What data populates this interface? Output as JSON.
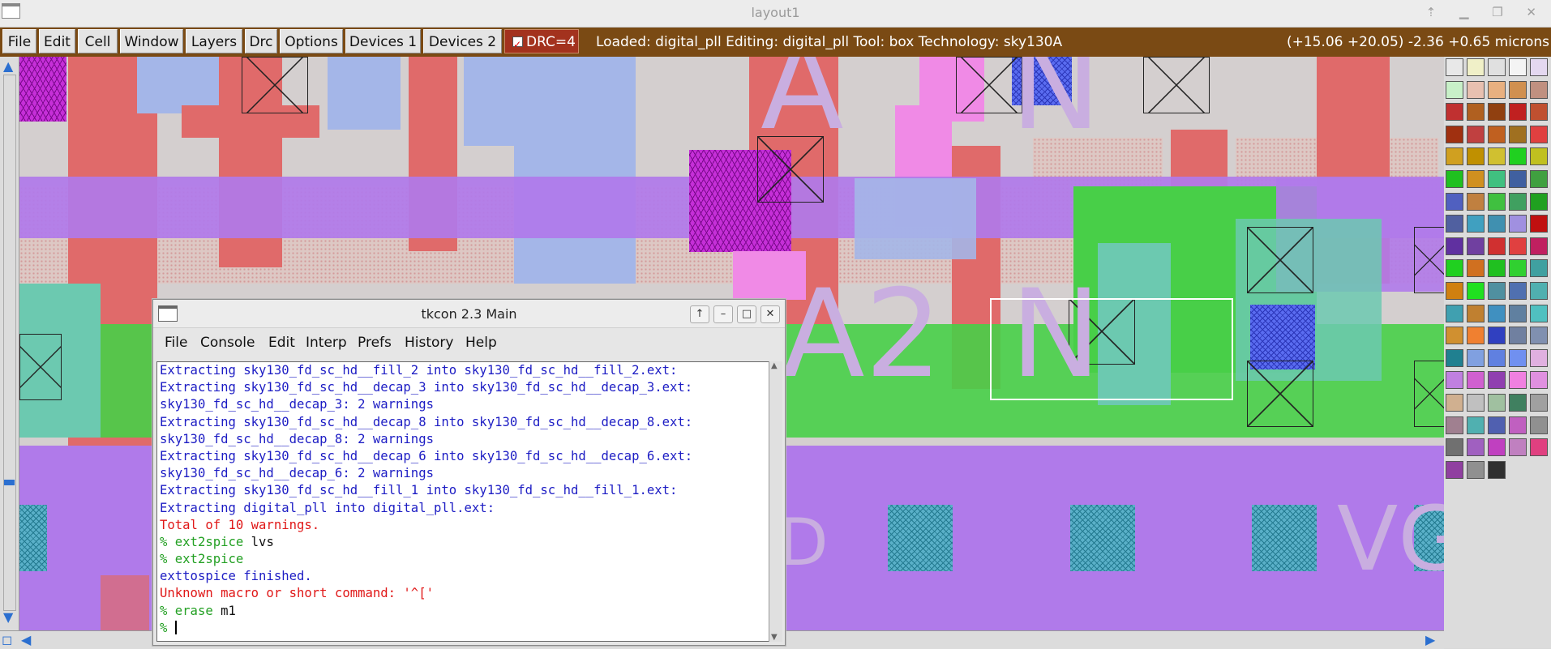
{
  "window": {
    "title": "layout1"
  },
  "menubar": {
    "items": [
      "File",
      "Edit",
      "Cell",
      "Window",
      "Layers",
      "Drc",
      "Options",
      "Devices 1",
      "Devices 2"
    ],
    "drc_label": "DRC=4",
    "drc_checked": true,
    "status": "Loaded: digital_pll Editing: digital_pll Tool: box  Technology: sky130A",
    "coords": "(+15.06 +20.05) -2.36 +0.65 microns"
  },
  "canvas": {
    "labels": [
      "A",
      "N",
      "A2",
      "N",
      "VG"
    ]
  },
  "tkcon": {
    "title": "tkcon 2.3 Main",
    "menu": [
      "File",
      "Console",
      "Edit",
      "Interp",
      "Prefs",
      "History",
      "Help"
    ],
    "lines": [
      {
        "color": "blue",
        "text": "Extracting sky130_fd_sc_hd__fill_2 into sky130_fd_sc_hd__fill_2.ext:"
      },
      {
        "color": "blue",
        "text": "Extracting sky130_fd_sc_hd__decap_3 into sky130_fd_sc_hd__decap_3.ext:"
      },
      {
        "color": "blue",
        "text": "sky130_fd_sc_hd__decap_3: 2 warnings"
      },
      {
        "color": "blue",
        "text": "Extracting sky130_fd_sc_hd__decap_8 into sky130_fd_sc_hd__decap_8.ext:"
      },
      {
        "color": "blue",
        "text": "sky130_fd_sc_hd__decap_8: 2 warnings"
      },
      {
        "color": "blue",
        "text": "Extracting sky130_fd_sc_hd__decap_6 into sky130_fd_sc_hd__decap_6.ext:"
      },
      {
        "color": "blue",
        "text": "sky130_fd_sc_hd__decap_6: 2 warnings"
      },
      {
        "color": "blue",
        "text": "Extracting sky130_fd_sc_hd__fill_1 into sky130_fd_sc_hd__fill_1.ext:"
      },
      {
        "color": "blue",
        "text": "Extracting digital_pll into digital_pll.ext:"
      },
      {
        "color": "red",
        "text": "Total of 10 warnings."
      }
    ],
    "commands": [
      {
        "prompt": "% ",
        "cmd": "ext2spice",
        "arg": " lvs"
      },
      {
        "prompt": "% ",
        "cmd": "ext2spice",
        "arg": ""
      }
    ],
    "after": [
      {
        "color": "blue",
        "text": "exttospice finished."
      },
      {
        "color": "red",
        "text": "Unknown macro or short command: '^['"
      }
    ],
    "last_command": {
      "prompt": "% ",
      "cmd": "erase",
      "arg": " m1"
    },
    "input_prompt": "% "
  },
  "palette": {
    "colors": [
      "#e8e8e8",
      "#f0f0c8",
      "#e0e0e0",
      "#f4f4f4",
      "#e4d8f0",
      "#c8f0c8",
      "#e8c0b0",
      "#e8b080",
      "#d09050",
      "#c09080",
      "#c03030",
      "#b06020",
      "#904010",
      "#c02020",
      "#c05030",
      "#a03010",
      "#c04040",
      "#c06020",
      "#a07020",
      "#e04040",
      "#d0a020",
      "#c09000",
      "#d0c030",
      "#20d020",
      "#c0c020",
      "#20c020",
      "#d09020",
      "#40c080",
      "#4060a0",
      "#40a040",
      "#5060c0",
      "#c08040",
      "#40c040",
      "#40a060",
      "#20a020",
      "#5060a0",
      "#40a0c0",
      "#4090b0",
      "#a090e0",
      "#c01010",
      "#6030a0",
      "#7040a0",
      "#d03030",
      "#e04040",
      "#c02060",
      "#20d020",
      "#d07020",
      "#20c020",
      "#30d030",
      "#40a0a0",
      "#d08010",
      "#20e020",
      "#5090a0",
      "#5070b0",
      "#50b0b0",
      "#40a0b0",
      "#c08030",
      "#4090c0",
      "#6080a0",
      "#50c0c0",
      "#d09030",
      "#f08030",
      "#3040c0",
      "#7080a0",
      "#8090b0",
      "#208090",
      "#80a0e0",
      "#6080e0",
      "#7090f0",
      "#e0b0e0",
      "#c080e0",
      "#d060d0",
      "#9040b0",
      "#f080e0",
      "#e090e0",
      "#d0b090",
      "#c0c0c0",
      "#a0c0a0",
      "#408060",
      "#a0a0a0",
      "#a08090",
      "#50b0b0",
      "#5060b0",
      "#c060c0",
      "#909090",
      "#707070",
      "#a060c0",
      "#c040c0",
      "#c080c0",
      "#e04080",
      "#9040a0",
      "#909090",
      "#303030"
    ]
  }
}
